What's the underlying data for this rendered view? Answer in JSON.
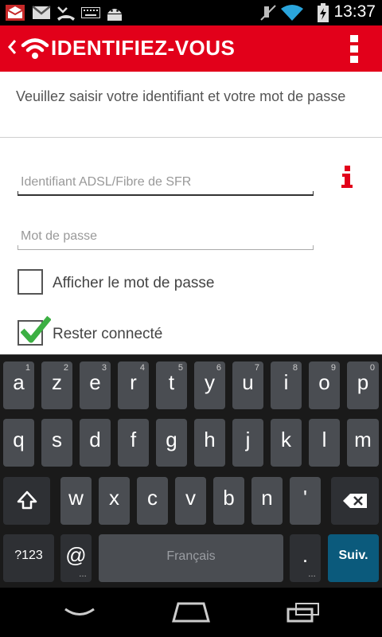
{
  "status_bar": {
    "time": "13:37",
    "icons": [
      "mail-notification-icon",
      "gmail-icon",
      "missed-call-icon",
      "keyboard-icon",
      "android-icon",
      "mute-icon",
      "wifi-icon",
      "battery-charging-icon"
    ]
  },
  "action_bar": {
    "title": "IDENTIFIEZ-VOUS",
    "icons": [
      "back-chevron-icon",
      "wifi-logo-icon",
      "overflow-menu-icon"
    ]
  },
  "form": {
    "instruction": "Veuillez saisir votre identifiant et votre mot de passe",
    "username_placeholder": "Identifiant ADSL/Fibre de SFR",
    "password_placeholder": "Mot de passe",
    "show_password_label": "Afficher le mot de passe",
    "show_password_checked": false,
    "stay_connected_label": "Rester connecté",
    "stay_connected_checked": true,
    "accent_color": "#e2001a"
  },
  "keyboard": {
    "row1": [
      {
        "key": "a",
        "hint": "1"
      },
      {
        "key": "z",
        "hint": "2"
      },
      {
        "key": "e",
        "hint": "3"
      },
      {
        "key": "r",
        "hint": "4"
      },
      {
        "key": "t",
        "hint": "5"
      },
      {
        "key": "y",
        "hint": "6"
      },
      {
        "key": "u",
        "hint": "7"
      },
      {
        "key": "i",
        "hint": "8"
      },
      {
        "key": "o",
        "hint": "9"
      },
      {
        "key": "p",
        "hint": "0"
      }
    ],
    "row2": [
      "q",
      "s",
      "d",
      "f",
      "g",
      "h",
      "j",
      "k",
      "l",
      "m"
    ],
    "row3": [
      "w",
      "x",
      "c",
      "v",
      "b",
      "n",
      "'"
    ],
    "symbols_label": "?123",
    "at_label": "@",
    "space_label": "Français",
    "period_label": ".",
    "next_label": "Suiv."
  }
}
